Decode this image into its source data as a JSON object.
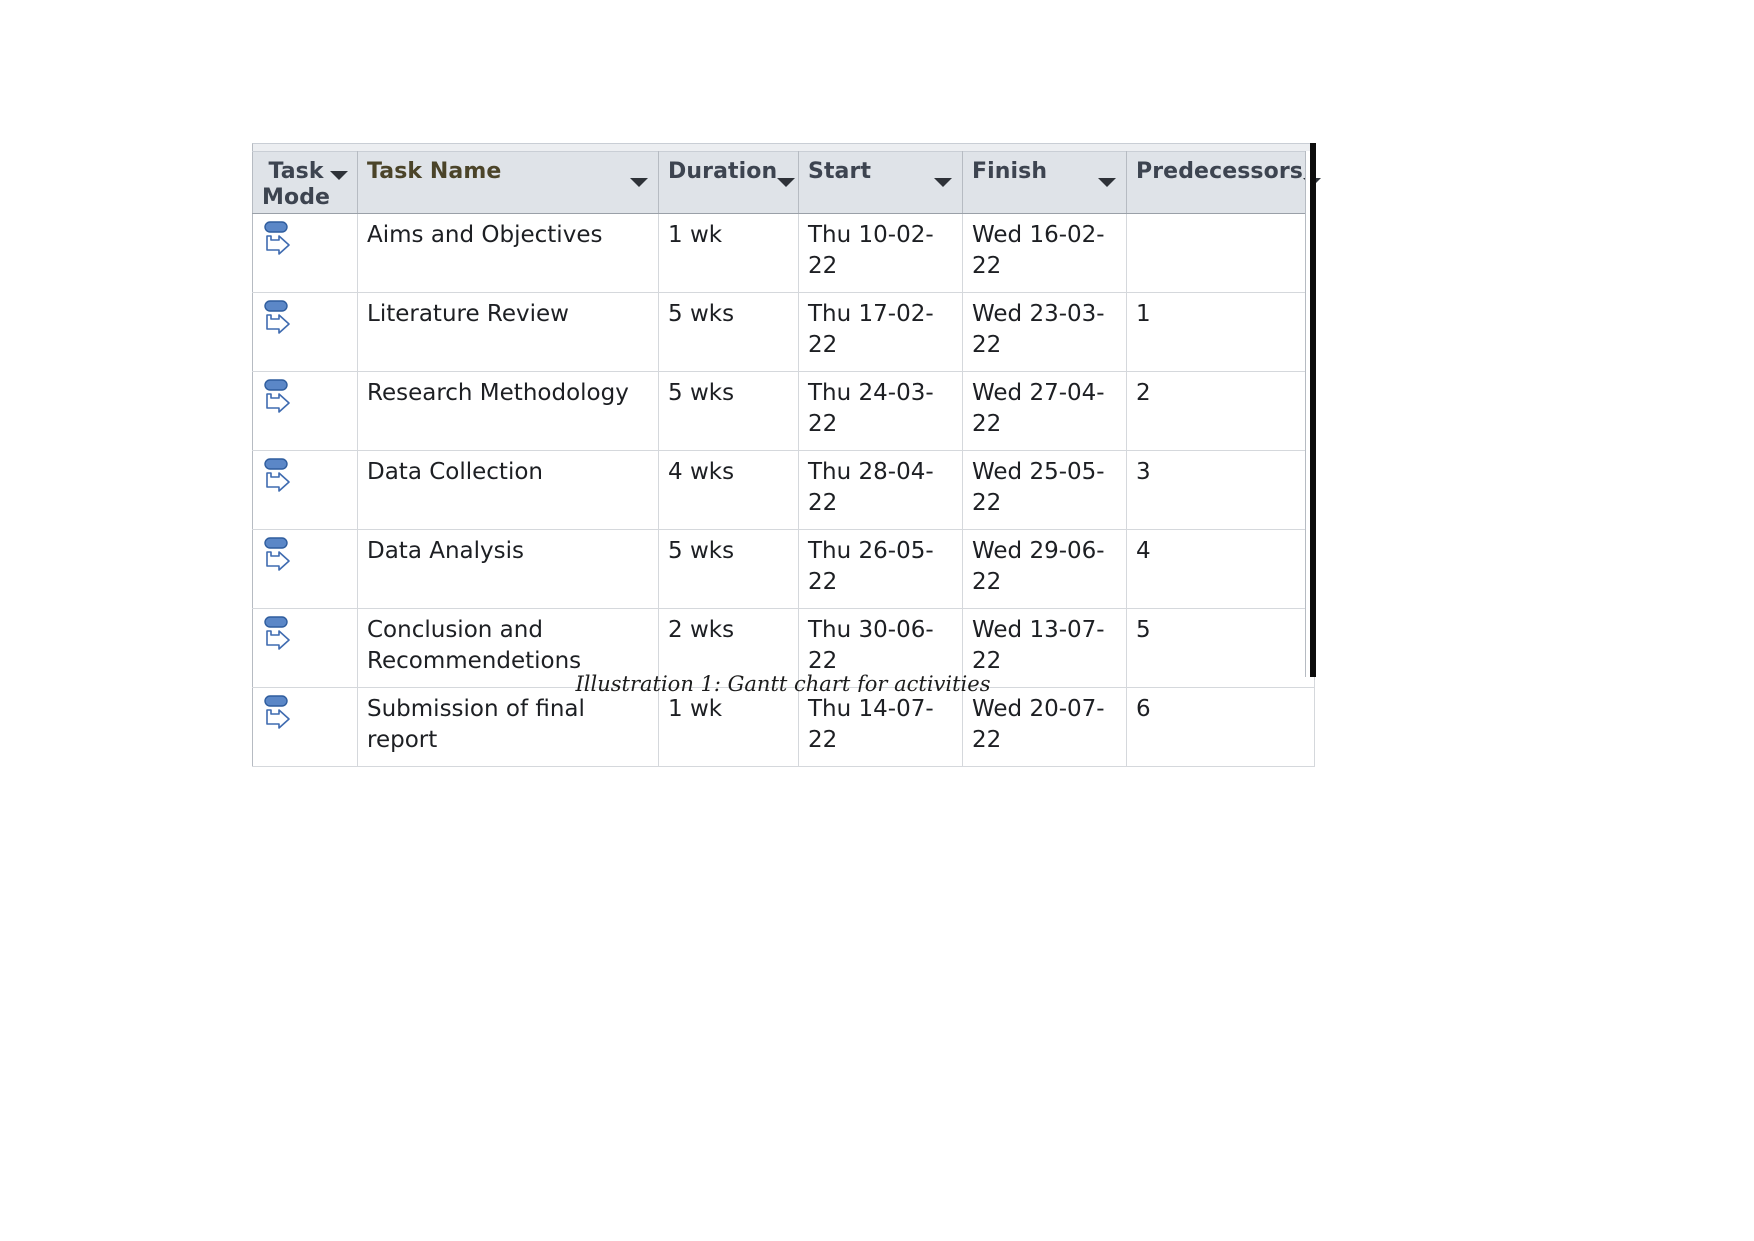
{
  "document": {
    "caption": "Illustration 1: Gantt chart for activities"
  },
  "table": {
    "columns": [
      {
        "key": "task_mode",
        "label": "Task\nMode",
        "icon": "filter-dropdown-arrow"
      },
      {
        "key": "task_name",
        "label": "Task Name",
        "icon": "filter-dropdown-arrow",
        "highlight_color": "#FFD34D"
      },
      {
        "key": "duration",
        "label": "Duration",
        "icon": "filter-dropdown-arrow"
      },
      {
        "key": "start",
        "label": "Start",
        "icon": "filter-dropdown-arrow"
      },
      {
        "key": "finish",
        "label": "Finish",
        "icon": "filter-dropdown-arrow"
      },
      {
        "key": "predecessors",
        "label": "Predecessors",
        "icon": "filter-dropdown-arrow"
      }
    ],
    "header_background": "#DFE3E8",
    "rows": [
      {
        "task_mode_icon": "manually-scheduled-task-icon",
        "task_name": "Aims and Objectives",
        "duration": "1 wk",
        "start": "Thu 10-02-22",
        "finish": "Wed 16-02-22",
        "predecessors": ""
      },
      {
        "task_mode_icon": "manually-scheduled-task-icon",
        "task_name": "Literature Review",
        "duration": "5 wks",
        "start": "Thu 17-02-22",
        "finish": "Wed 23-03-22",
        "predecessors": "1"
      },
      {
        "task_mode_icon": "manually-scheduled-task-icon",
        "task_name": "Research Methodology",
        "duration": "5 wks",
        "start": "Thu 24-03-22",
        "finish": "Wed 27-04-22",
        "predecessors": "2"
      },
      {
        "task_mode_icon": "manually-scheduled-task-icon",
        "task_name": "Data Collection",
        "duration": "4 wks",
        "start": "Thu 28-04-22",
        "finish": "Wed 25-05-22",
        "predecessors": "3"
      },
      {
        "task_mode_icon": "manually-scheduled-task-icon",
        "task_name": "Data Analysis",
        "duration": "5 wks",
        "start": "Thu 26-05-22",
        "finish": "Wed 29-06-22",
        "predecessors": "4"
      },
      {
        "task_mode_icon": "manually-scheduled-task-icon",
        "task_name": "Conclusion and Recommendetions",
        "duration": "2 wks",
        "start": "Thu 30-06-22",
        "finish": "Wed 13-07-22",
        "predecessors": "5"
      },
      {
        "task_mode_icon": "manually-scheduled-task-icon",
        "task_name": "Submission of final report",
        "duration": "1 wk",
        "start": "Thu 14-07-22",
        "finish": "Wed 20-07-22",
        "predecessors": "6"
      }
    ]
  }
}
